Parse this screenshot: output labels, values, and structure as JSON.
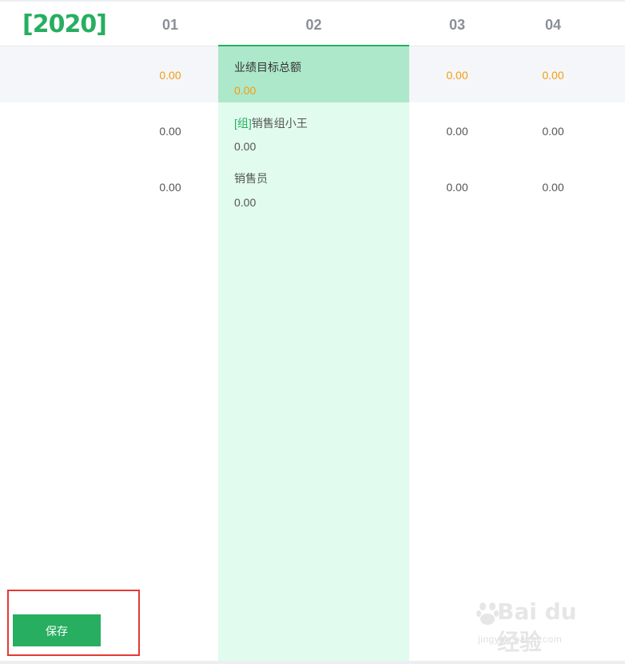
{
  "year_label": "[2020]",
  "columns": [
    {
      "label": "01"
    },
    {
      "label": "02"
    },
    {
      "label": "03"
    },
    {
      "label": "04"
    }
  ],
  "total_row": {
    "label": "业绩目标总额",
    "values": [
      "0.00",
      "0.00",
      "0.00",
      "0.00"
    ]
  },
  "rows": [
    {
      "prefix": "[组]",
      "label": "销售组小王",
      "values": [
        "0.00",
        "0.00",
        "0.00",
        "0.00"
      ]
    },
    {
      "prefix": "",
      "label": "销售员",
      "values": [
        "0.00",
        "0.00",
        "0.00",
        "0.00"
      ]
    }
  ],
  "actions": {
    "save_label": "保存"
  },
  "watermark": {
    "brand": "Bai du 经验",
    "url": "jingyan.baidu.com"
  },
  "colors": {
    "accent": "#27ae60",
    "amount_highlight": "#f39c12",
    "selected_column": "#e1fbee",
    "selected_header": "#aee8ca",
    "focus_frame": "#e53935"
  }
}
